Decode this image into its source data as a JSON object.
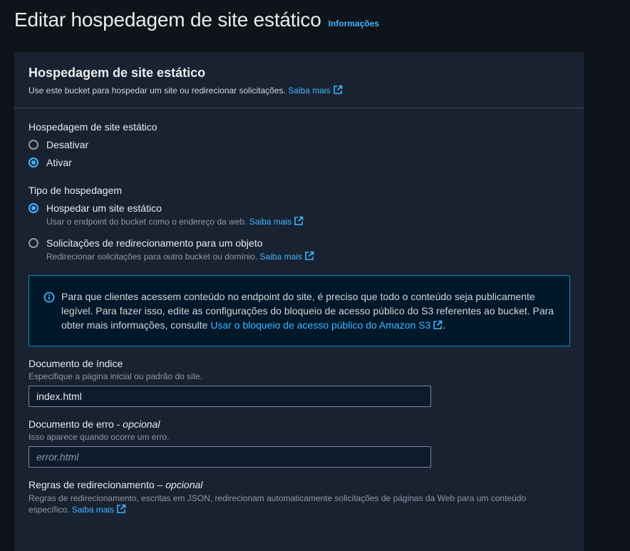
{
  "header": {
    "title": "Editar hospedagem de site estático",
    "info_link": "Informações"
  },
  "panel": {
    "title": "Hospedagem de site estático",
    "description": "Use este bucket para hospedar um site ou redirecionar solicitações.",
    "learn_more": "Saiba mais"
  },
  "hosting": {
    "label": "Hospedagem de site estático",
    "options": [
      {
        "label": "Desativar",
        "checked": false
      },
      {
        "label": "Ativar",
        "checked": true
      }
    ]
  },
  "hosting_type": {
    "label": "Tipo de hospedagem",
    "options": [
      {
        "label": "Hospedar um site estático",
        "description": "Usar o endpoint do bucket como o endereço da web.",
        "learn_more": "Saiba mais",
        "checked": true
      },
      {
        "label": "Solicitações de redirecionamento para um objeto",
        "description": "Redirecionar solicitações para outro bucket ou domínio.",
        "learn_more": "Saiba mais",
        "checked": false
      }
    ]
  },
  "info_alert": {
    "text": "Para que clientes acessem conteúdo no endpoint do site, é preciso que todo o conteúdo seja publicamente legível. Para fazer isso, edite as configurações do bloqueio de acesso público do S3 referentes ao bucket. Para obter mais informações, consulte",
    "link": "Usar o bloqueio de acesso público do Amazon S3",
    "suffix": "."
  },
  "index_document": {
    "label": "Documento de índice",
    "description": "Especifique a página inicial ou padrão do site.",
    "value": "index.html"
  },
  "error_document": {
    "label": "Documento de erro -",
    "optional": "opcional",
    "description": "Isso aparece quando ocorre um erro.",
    "placeholder": "error.html"
  },
  "redirect_rules": {
    "label": "Regras de redirecionamento –",
    "optional": "opcional",
    "description": "Regras de redirecionamento, escritas em JSON, redirecionam automaticamente solicitações de páginas da Web para um conteúdo específico.",
    "learn_more": "Saiba mais"
  },
  "colors": {
    "background": "#0f141a",
    "panel": "#192231",
    "accent": "#42b4ff",
    "info_border": "#0a8fc7",
    "info_background": "#001829"
  }
}
